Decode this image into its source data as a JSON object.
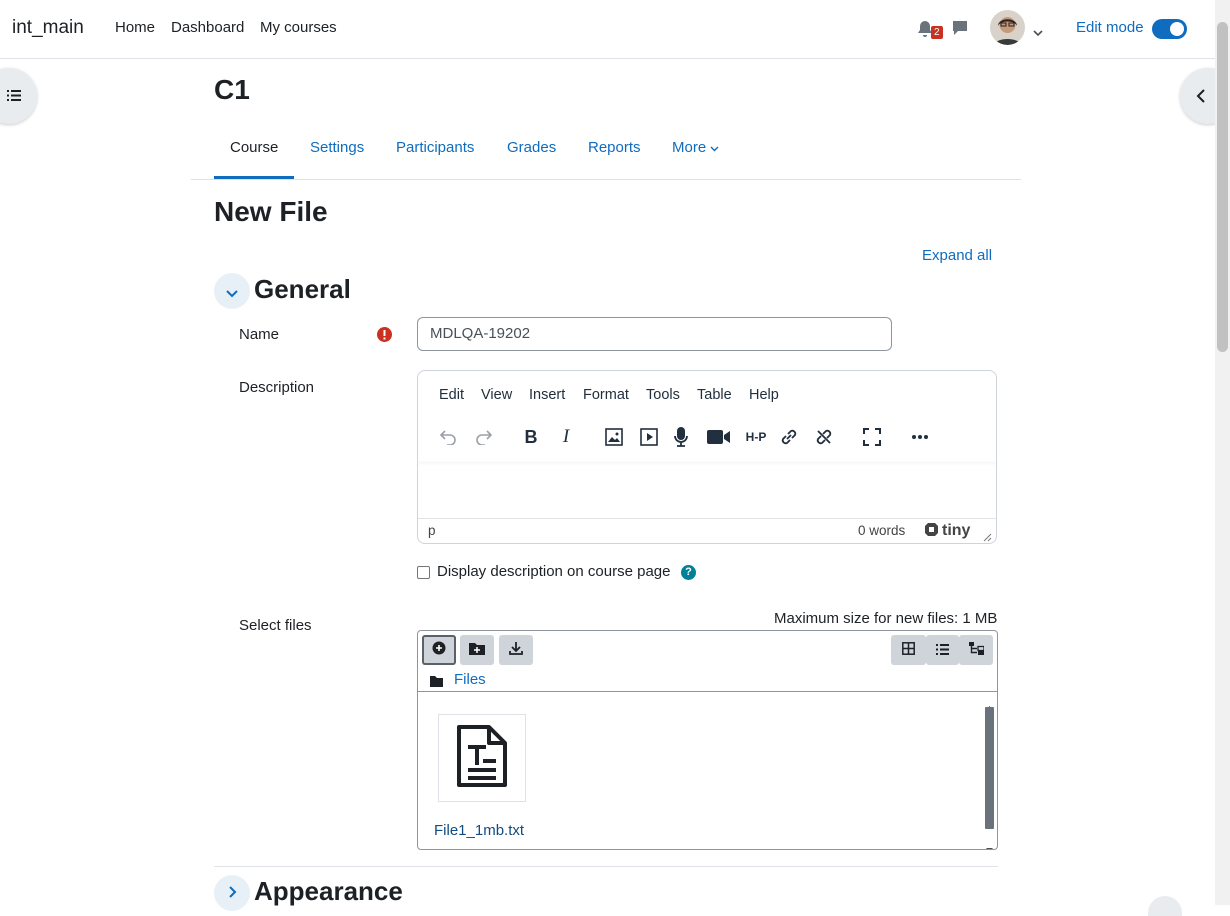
{
  "navbar": {
    "brand": "int_main",
    "links": [
      "Home",
      "Dashboard",
      "My courses"
    ],
    "notification_count": "2",
    "edit_mode_label": "Edit mode",
    "edit_mode_on": true
  },
  "course": {
    "title": "C1",
    "tabs": [
      "Course",
      "Settings",
      "Participants",
      "Grades",
      "Reports",
      "More"
    ],
    "active_tab": "Course"
  },
  "page": {
    "heading": "New File",
    "expand_all": "Expand all"
  },
  "general": {
    "section_title": "General",
    "name_label": "Name",
    "name_value": "MDLQA-19202",
    "description_label": "Description",
    "editor": {
      "menu": [
        "Edit",
        "View",
        "Insert",
        "Format",
        "Tools",
        "Table",
        "Help"
      ],
      "toolbar_icons": [
        "undo-icon",
        "redo-icon",
        "bold-icon",
        "italic-icon",
        "image-icon",
        "media-icon",
        "record-audio-icon",
        "record-video-icon",
        "h5p-icon",
        "link-icon",
        "unlink-icon",
        "fullscreen-icon",
        "more-icon"
      ],
      "element_path": "p",
      "word_count": "0 words",
      "branding": "tiny"
    },
    "display_description_label": "Display description on course page",
    "select_files_label": "Select files",
    "max_size_text": "Maximum size for new files: 1 MB",
    "filemanager": {
      "path_label": "Files",
      "files": [
        {
          "name": "File1_1mb.txt",
          "icon": "text-file-icon"
        }
      ]
    }
  },
  "appearance": {
    "section_title": "Appearance"
  },
  "colors": {
    "link": "#0f6cbf",
    "required": "#ca3120",
    "help": "#008196"
  }
}
